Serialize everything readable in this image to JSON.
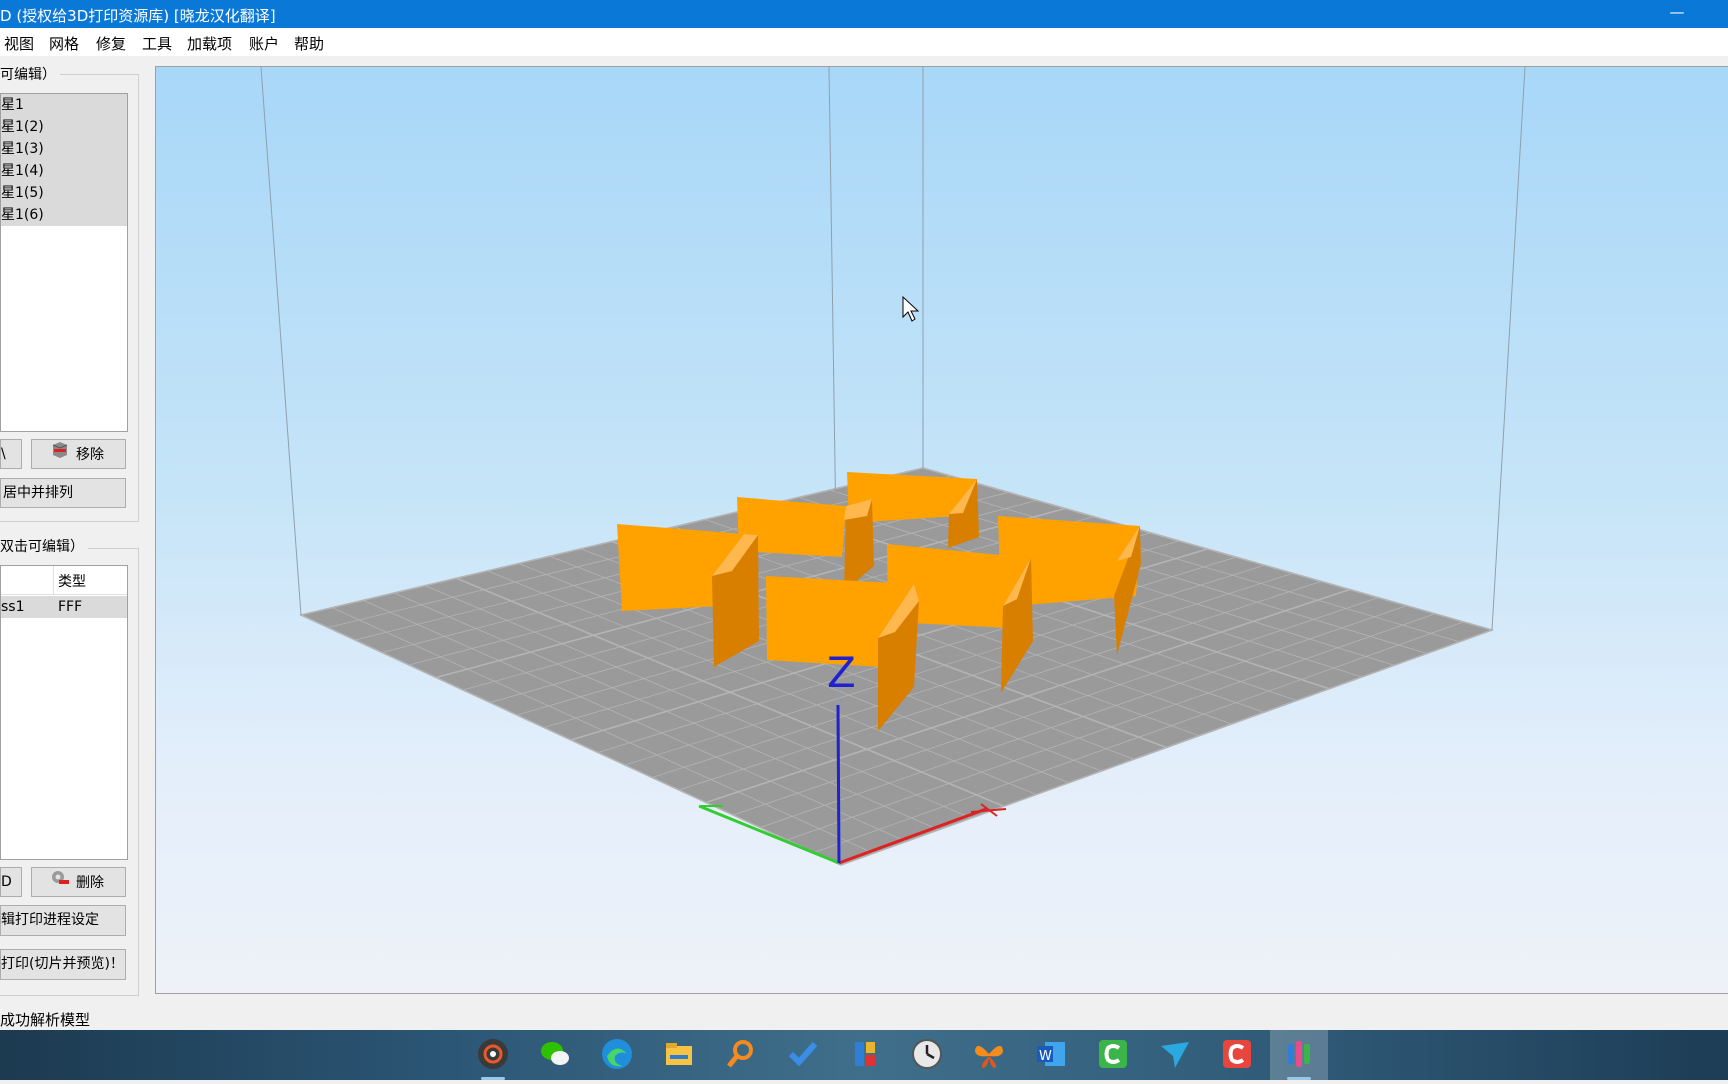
{
  "window": {
    "title": "D (授权给3D打印资源库) [晓龙汉化翻译]",
    "minimize_glyph": "—"
  },
  "menu": [
    "视图",
    "网格",
    "修复",
    "工具",
    "加载项",
    "账户",
    "帮助"
  ],
  "models_panel": {
    "label": "可编辑）",
    "items": [
      "星1",
      "星1(2)",
      "星1(3)",
      "星1(4)",
      "星1(5)",
      "星1(6)"
    ],
    "add_button": "\\",
    "remove_button": "移除",
    "center_arrange_button": "居中并排列"
  },
  "process_panel": {
    "label": "双击可编辑）",
    "columns": [
      "",
      "类型"
    ],
    "rows": [
      {
        "name": "ss1",
        "type": "FFF"
      }
    ],
    "add_button": "D",
    "delete_button": "删除",
    "edit_process_button": "辑打印进程设定",
    "prepare_button": "打印(切片并预览)！"
  },
  "viewport": {
    "axis_label_z": "Z",
    "colors": {
      "model": "#ffa200",
      "bed": "#999999",
      "axis_x": "#dd2222",
      "axis_y": "#33cc33",
      "axis_z": "#2222cc"
    },
    "model_count": 6
  },
  "status": {
    "text": "成功解析模型"
  },
  "taskbar": {
    "icons": [
      "music-player-icon",
      "wechat-icon",
      "edge-browser-icon",
      "file-explorer-icon",
      "search-magnifier-icon",
      "todo-check-icon",
      "app-tiles-icon",
      "clock-icon",
      "butterfly-icon",
      "word-icon",
      "camtasia-green-icon",
      "send-arrow-icon",
      "camtasia-red-icon",
      "simplify3d-icon"
    ]
  }
}
